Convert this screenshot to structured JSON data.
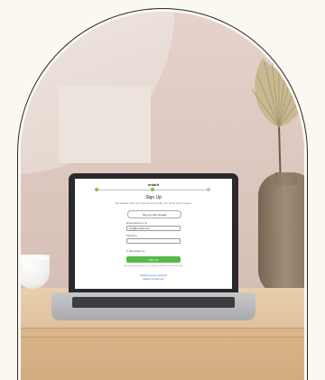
{
  "screen": {
    "brand": "ontarit",
    "title": "Sign Up",
    "subtitle": "Get started with your free account today. No credit card needed.",
    "social_button": "Sign up with Google",
    "email_label": "Email address or ID",
    "email_value": "you@fremail.com",
    "password_label": "Password",
    "password_value": "",
    "checkbox_label": "Remember me",
    "cta_label": "Sign Up",
    "terms": "By signing up you agree to our Terms of Service and Privacy Policy",
    "link_login": "Already have an account?",
    "link_help": "Need to contact us?"
  },
  "colors": {
    "accent_green": "#57b94a",
    "link_blue": "#2d6dbf"
  }
}
